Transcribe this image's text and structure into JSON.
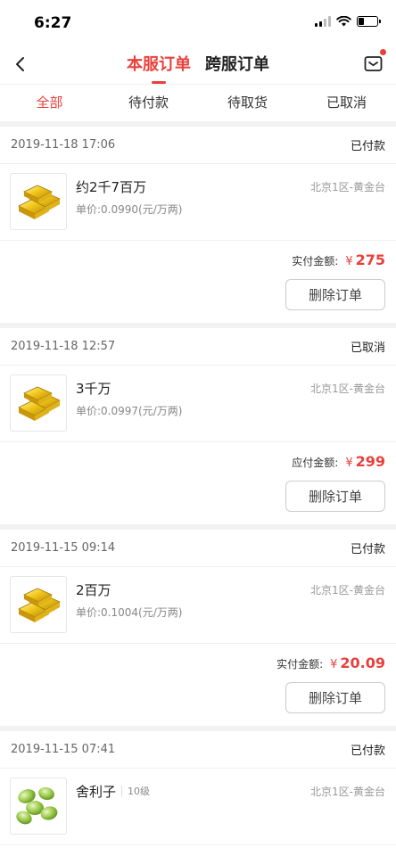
{
  "status_bar": {
    "time": "6:27",
    "battery_level": 0.3
  },
  "nav": {
    "tabs": [
      {
        "label": "本服订单",
        "active": true
      },
      {
        "label": "跨服订单",
        "active": false
      }
    ],
    "back_icon": "chevron-left-icon",
    "message_icon": "mail-icon",
    "message_has_badge": true
  },
  "filters": [
    {
      "label": "全部",
      "active": true
    },
    {
      "label": "待付款",
      "active": false
    },
    {
      "label": "待取货",
      "active": false
    },
    {
      "label": "已取消",
      "active": false
    }
  ],
  "colors": {
    "accent": "#e8413c",
    "divider": "#f2f2f2"
  },
  "orders": [
    {
      "time": "2019-11-18 17:06",
      "status": "已付款",
      "name": "约2千7百万",
      "level": "",
      "price": "单价:0.0990(元/万两)",
      "server": "北京1区-黄金台",
      "amount_label": "实付金额:",
      "currency": "¥",
      "amount": "275",
      "delete_label": "删除订单",
      "icon": "gold-bar-icon"
    },
    {
      "time": "2019-11-18 12:57",
      "status": "已取消",
      "name": "3千万",
      "level": "",
      "price": "单价:0.0997(元/万两)",
      "server": "北京1区-黄金台",
      "amount_label": "应付金额:",
      "currency": "¥",
      "amount": "299",
      "delete_label": "删除订单",
      "icon": "gold-bar-icon"
    },
    {
      "time": "2019-11-15 09:14",
      "status": "已付款",
      "name": "2百万",
      "level": "",
      "price": "单价:0.1004(元/万两)",
      "server": "北京1区-黄金台",
      "amount_label": "实付金额:",
      "currency": "¥",
      "amount": "20.09",
      "delete_label": "删除订单",
      "icon": "gold-bar-icon"
    },
    {
      "time": "2019-11-15 07:41",
      "status": "已付款",
      "name": "舍利子",
      "level": "10级",
      "price": "",
      "server": "北京1区-黄金台",
      "amount_label": "",
      "currency": "",
      "amount": "",
      "delete_label": "",
      "icon": "green-pearls-icon"
    }
  ]
}
